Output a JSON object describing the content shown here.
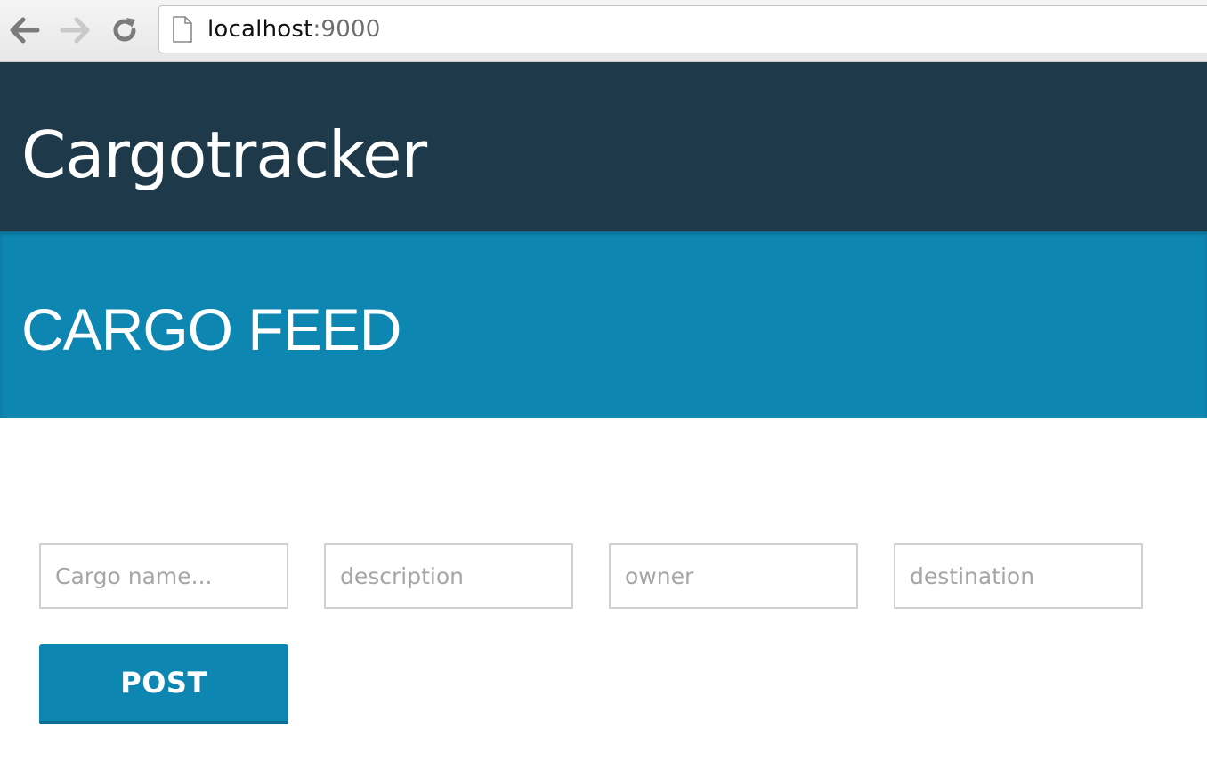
{
  "browser": {
    "url_host": "localhost",
    "url_port": ":9000",
    "icons": {
      "back": "arrow-left-icon",
      "forward": "arrow-right-icon",
      "reload": "reload-icon",
      "page": "document-icon"
    }
  },
  "header": {
    "title": "Cargotracker"
  },
  "section": {
    "title": "CARGO FEED"
  },
  "form": {
    "name_placeholder": "Cargo name...",
    "description_placeholder": "description",
    "owner_placeholder": "owner",
    "destination_placeholder": "destination",
    "post_label": "POST"
  },
  "colors": {
    "header_bg": "#1e3a4a",
    "accent": "#0e86b2"
  }
}
